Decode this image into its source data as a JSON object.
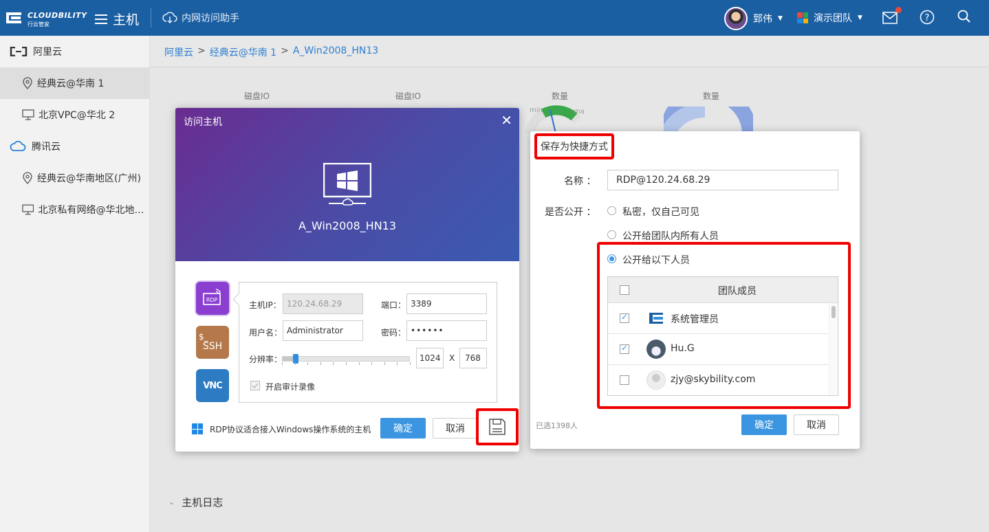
{
  "topbar": {
    "logo_text": "CLOUDBILITY",
    "logo_sub": "行云管家",
    "menu_label": "主机",
    "assist_label": "内网访问助手",
    "user_name": "郅伟",
    "team_name": "演示团队"
  },
  "sidebar": {
    "items": [
      {
        "label": "阿里云",
        "kind": "group",
        "icon": "aliyun-icon"
      },
      {
        "label": "经典云@华南 1",
        "kind": "sub",
        "icon": "location-pin-icon",
        "active": true
      },
      {
        "label": "北京VPC@华北 2",
        "kind": "sub",
        "icon": "monitor-icon"
      },
      {
        "label": "腾讯云",
        "kind": "group",
        "icon": "tencent-cloud-icon"
      },
      {
        "label": "经典云@华南地区(广州)",
        "kind": "sub",
        "icon": "location-pin-icon"
      },
      {
        "label": "北京私有网络@华北地区...",
        "kind": "sub",
        "icon": "monitor-icon"
      }
    ]
  },
  "breadcrumb": [
    "阿里云",
    "经典云@华南 1",
    "A_Win2008_HN13"
  ],
  "background": {
    "gauge_labels": [
      "磁盘IO",
      "磁盘IO",
      "数量",
      "数量"
    ],
    "gauge_min": "min",
    "gauge_max": "max",
    "log_title": "主机日志"
  },
  "access_dialog": {
    "title": "访问主机",
    "host_name": "A_Win2008_HN13",
    "protocols": [
      "RDP",
      "SSH",
      "VNC"
    ],
    "ssh_prompt": "$_",
    "vnc_label": "VNC",
    "host_ip_label": "主机IP：",
    "host_ip_value": "120.24.68.29",
    "port_label": "端口：",
    "port_value": "3389",
    "username_label": "用户名：",
    "username_value": "Administrator",
    "password_label": "密码：",
    "password_value": "••••••",
    "resolution_label": "分辨率：",
    "res_width": "1024",
    "res_x": "X",
    "res_height": "768",
    "resolution_slider_fraction": 0.1,
    "audit_label": "开启审计录像",
    "footer_text": "RDP协议适合接入Windows操作系统的主机",
    "confirm": "确定",
    "cancel": "取消"
  },
  "shortcut_dialog": {
    "title": "保存为快捷方式",
    "name_label": "名称 ：",
    "name_value": "RDP@120.24.68.29",
    "public_label": "是否公开 ：",
    "options": [
      "私密，仅自己可见",
      "公开给团队内所有人员",
      "公开给以下人员"
    ],
    "selected_option": 2,
    "table_header": "团队成员",
    "members": [
      {
        "name": "系统管理员",
        "checked": true
      },
      {
        "name": "Hu.G",
        "checked": true
      },
      {
        "name": "zjy@skybility.com",
        "checked": false
      }
    ],
    "selected_count": "已选1398人",
    "confirm": "确定",
    "cancel": "取消"
  },
  "colors": {
    "topbar": "#1b5fa3",
    "primary": "#3b95e0",
    "highlight": "#ee0000"
  }
}
